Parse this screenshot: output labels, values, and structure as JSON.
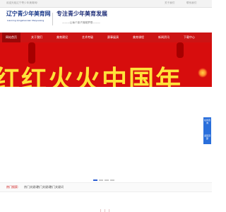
{
  "topbar": {
    "left_text": "欢迎光临辽宁青少年美育网!",
    "about": "关于我们",
    "contact": "联系我们"
  },
  "logo": {
    "name_cn": "辽宁青少年美育网",
    "name_en": "Liaoning Qingshaonian Meiyuwang"
  },
  "header": {
    "slogan": "专注青少年美育发展",
    "subslogan": "———让每个孩子拥抱梦想———"
  },
  "nav": {
    "items": [
      {
        "label": "网站首页",
        "active": true
      },
      {
        "label": "关于我们",
        "active": false
      },
      {
        "label": "美育建设",
        "active": false
      },
      {
        "label": "艺术考级",
        "active": false
      },
      {
        "label": "赛事展演",
        "active": false
      },
      {
        "label": "美育课程",
        "active": false
      },
      {
        "label": "新闻资讯",
        "active": false
      },
      {
        "label": "下载中心",
        "active": false
      }
    ]
  },
  "banner": {
    "text": "红红火火中国年"
  },
  "slider": {
    "count": 4,
    "active_index": 0
  },
  "side_buttons": {
    "consult": "在线咨询",
    "top": "返回顶部"
  },
  "hot_search": {
    "title": "热门搜索:",
    "items": [
      "热门关键词",
      "热门关键词",
      "热门关键词"
    ]
  },
  "colors": {
    "brand_red": "#cc1414",
    "nav_active": "#9a0808",
    "banner_red": "#d70d0d",
    "accent_blue": "#2a6fdb",
    "logo_blue": "#1a3a8a"
  }
}
